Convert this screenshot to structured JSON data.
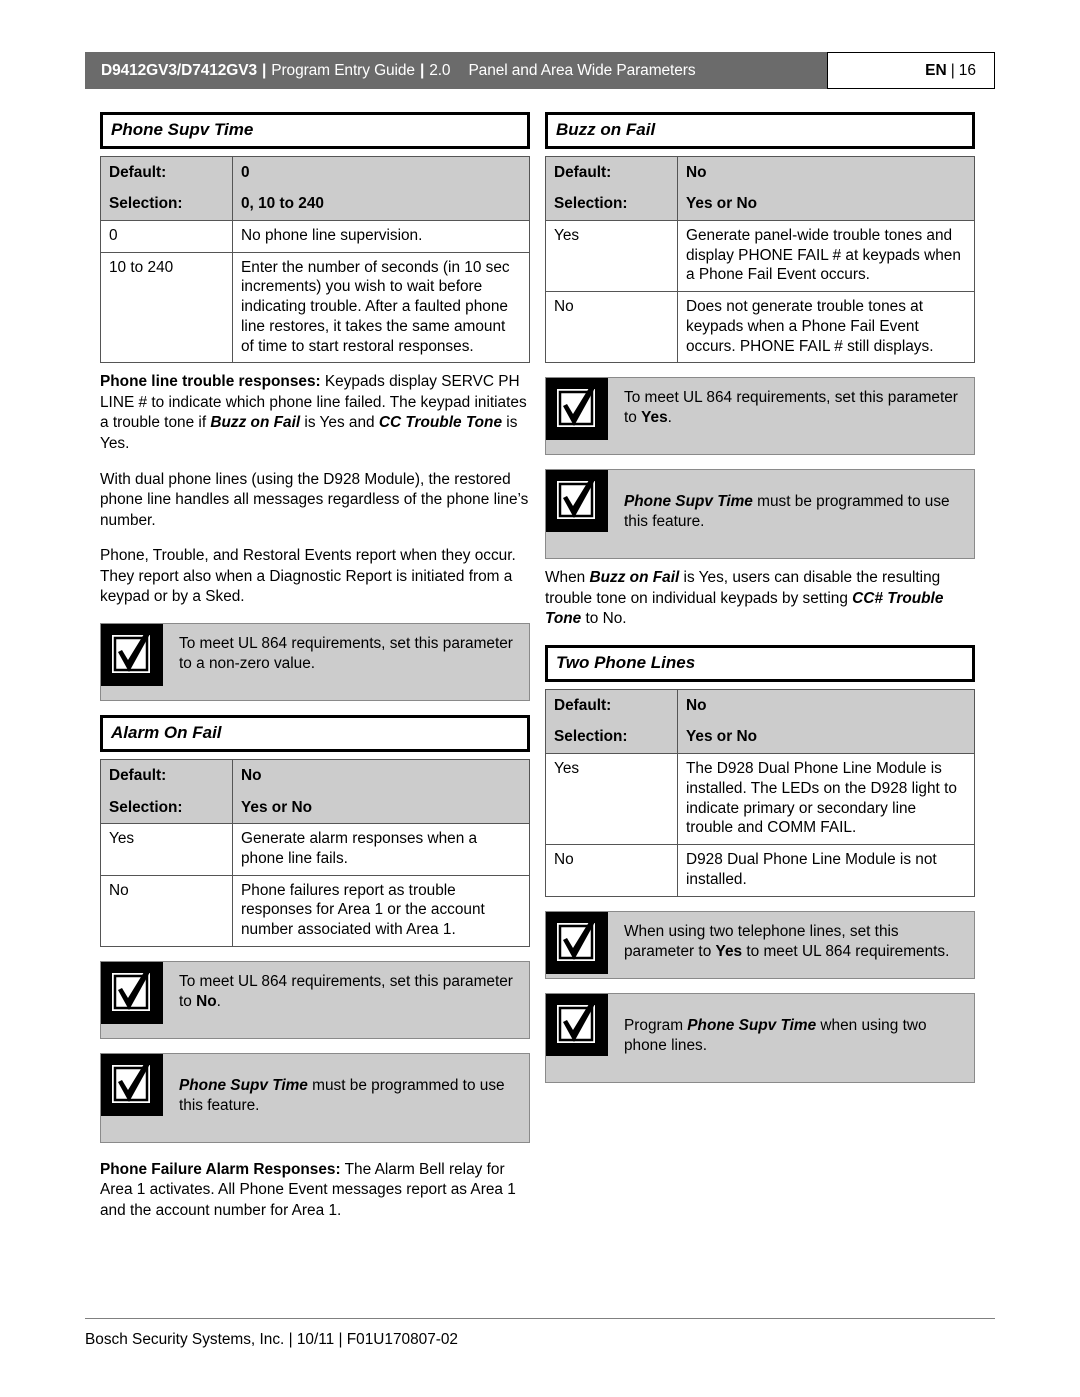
{
  "header": {
    "product": "D9412GV3/D7412GV3",
    "separator": "|",
    "guide": "Program Entry Guide",
    "version": "2.0",
    "section": "Panel and Area Wide Parameters",
    "language": "EN",
    "page_number": "16",
    "bar_color": "#6b6b6b",
    "text_color": "#ffffff"
  },
  "left_column": {
    "phone_supv_time": {
      "title": "Phone Supv Time",
      "meta": [
        {
          "label": "Default:",
          "value": "0"
        },
        {
          "label": "Selection:",
          "value": "0, 10 to 240"
        }
      ],
      "rows": [
        {
          "option": "0",
          "description": "No phone line supervision."
        },
        {
          "option": "10 to 240",
          "description": "Enter the number of seconds (in 10 sec increments) you wish to wait before indicating trouble. After a faulted phone line restores, it takes the same amount of time to start restoral responses."
        }
      ],
      "paragraphs": [
        {
          "lead": "Phone line trouble responses:",
          "body_1": " Keypads display SERVC PH LINE # to indicate which phone line failed. The keypad initiates a trouble tone if ",
          "em_1": "Buzz on Fail",
          "body_2": " is Yes and ",
          "em_2": "CC Trouble Tone",
          "body_3": " is Yes."
        },
        {
          "text": "With dual phone lines (using the D928 Module), the restored phone line handles all messages regardless of the phone line’s number."
        },
        {
          "text": "Phone, Trouble, and Restoral Events report when they occur. They report also when a Diagnostic Report is initiated from a keypad or by a Sked."
        }
      ],
      "notice": {
        "icon": "checkmark-icon",
        "text_1": "To meet UL 864 requirements, set this parameter to a non-zero value."
      }
    },
    "alarm_on_fail": {
      "title": "Alarm On Fail",
      "meta": [
        {
          "label": "Default:",
          "value": "No"
        },
        {
          "label": "Selection:",
          "value": "Yes or No"
        }
      ],
      "rows": [
        {
          "option": "Yes",
          "description": "Generate alarm responses when a phone line fails."
        },
        {
          "option": "No",
          "description": "Phone failures report as trouble responses for Area 1 or the account number associated with Area 1."
        }
      ],
      "notices": [
        {
          "icon": "checkmark-icon",
          "text_1": "To meet UL 864 requirements, set this parameter to ",
          "bold": "No",
          "text_2": "."
        },
        {
          "icon": "checkmark-icon",
          "em": "Phone Supv Time",
          "text_1": " must be programmed to use this feature."
        }
      ],
      "closing_paragraph": {
        "lead": "Phone Failure Alarm Responses:",
        "body": " The Alarm Bell relay for Area 1 activates. All Phone Event messages report as Area 1 and the account number for Area 1."
      }
    }
  },
  "right_column": {
    "buzz_on_fail": {
      "title": "Buzz on Fail",
      "meta": [
        {
          "label": "Default:",
          "value": "No"
        },
        {
          "label": "Selection:",
          "value": "Yes or No"
        }
      ],
      "rows": [
        {
          "option": "Yes",
          "description": "Generate panel-wide trouble tones and display PHONE FAIL # at keypads when a Phone Fail Event occurs."
        },
        {
          "option": "No",
          "description": "Does not generate trouble tones at keypads when a Phone Fail Event occurs. PHONE FAIL # still displays."
        }
      ],
      "notices": [
        {
          "icon": "checkmark-icon",
          "text_1": "To meet UL 864 requirements, set this parameter to ",
          "bold": "Yes",
          "text_2": "."
        },
        {
          "icon": "checkmark-icon",
          "em": "Phone Supv Time",
          "text_1": " must be programmed to use this feature."
        }
      ],
      "closing_paragraph": {
        "body_1": "When ",
        "em_1": "Buzz on Fail",
        "body_2": " is Yes, users can disable the resulting trouble tone on individual keypads by setting ",
        "em_2": "CC# Trouble Tone",
        "body_3": " to No."
      }
    },
    "two_phone_lines": {
      "title": "Two Phone Lines",
      "meta": [
        {
          "label": "Default:",
          "value": "No"
        },
        {
          "label": "Selection:",
          "value": "Yes or No"
        }
      ],
      "rows": [
        {
          "option": "Yes",
          "description": "The D928 Dual Phone Line Module is installed. The LEDs on the D928 light to indicate primary or secondary line trouble and COMM FAIL."
        },
        {
          "option": "No",
          "description": "D928 Dual Phone Line Module is not installed."
        }
      ],
      "notices": [
        {
          "icon": "checkmark-icon",
          "text_1": "When using two telephone lines, set this parameter to ",
          "bold": "Yes",
          "text_2": " to meet UL 864 requirements."
        },
        {
          "icon": "checkmark-icon",
          "text_1": "Program ",
          "em": "Phone Supv Time",
          "text_2": " when using two phone lines."
        }
      ]
    }
  },
  "footer": {
    "text": "Bosch Security Systems, Inc. | 10/11 | F01U170807-02"
  },
  "colors": {
    "header_gray": "#6b6b6b",
    "table_gray": "#cccccc",
    "border": "#555555",
    "black": "#000000"
  }
}
